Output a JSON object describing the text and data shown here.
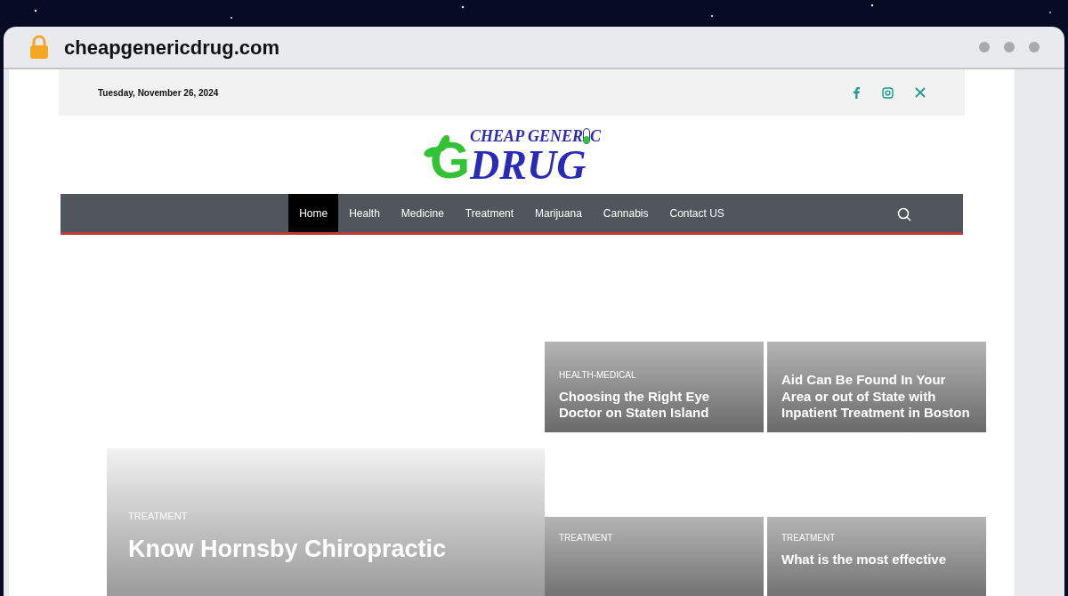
{
  "browser": {
    "url": "cheapgenericdrug.com"
  },
  "top_bar": {
    "date": "Tuesday, November 26, 2024",
    "social": [
      {
        "kind": "facebook"
      },
      {
        "kind": "instagram"
      },
      {
        "kind": "x"
      }
    ]
  },
  "logo": {
    "top": "CHEAP GENER",
    "top_end": "C",
    "initial": "G",
    "main": "DRUG"
  },
  "nav": [
    {
      "label": "Home",
      "selected": true
    },
    {
      "label": "Health",
      "selected": false
    },
    {
      "label": "Medicine",
      "selected": false
    },
    {
      "label": "Treatment",
      "selected": false
    },
    {
      "label": "Marijuana",
      "selected": false
    },
    {
      "label": "Cannabis",
      "selected": false
    },
    {
      "label": "Contact US",
      "selected": false
    }
  ],
  "featured": {
    "category": "TREATMENT",
    "title": "Know Hornsby Chiropractic"
  },
  "cards": [
    {
      "category": "HEALTH-MEDICAL",
      "title": "Choosing the Right Eye Doctor on Staten Island"
    },
    {
      "title": "Aid Can Be Found In Your Area or out of State with Inpatient Treatment in Boston"
    },
    {
      "category": "TREATMENT"
    },
    {
      "category": "TREATMENT",
      "title": "What is the most effective"
    }
  ]
}
